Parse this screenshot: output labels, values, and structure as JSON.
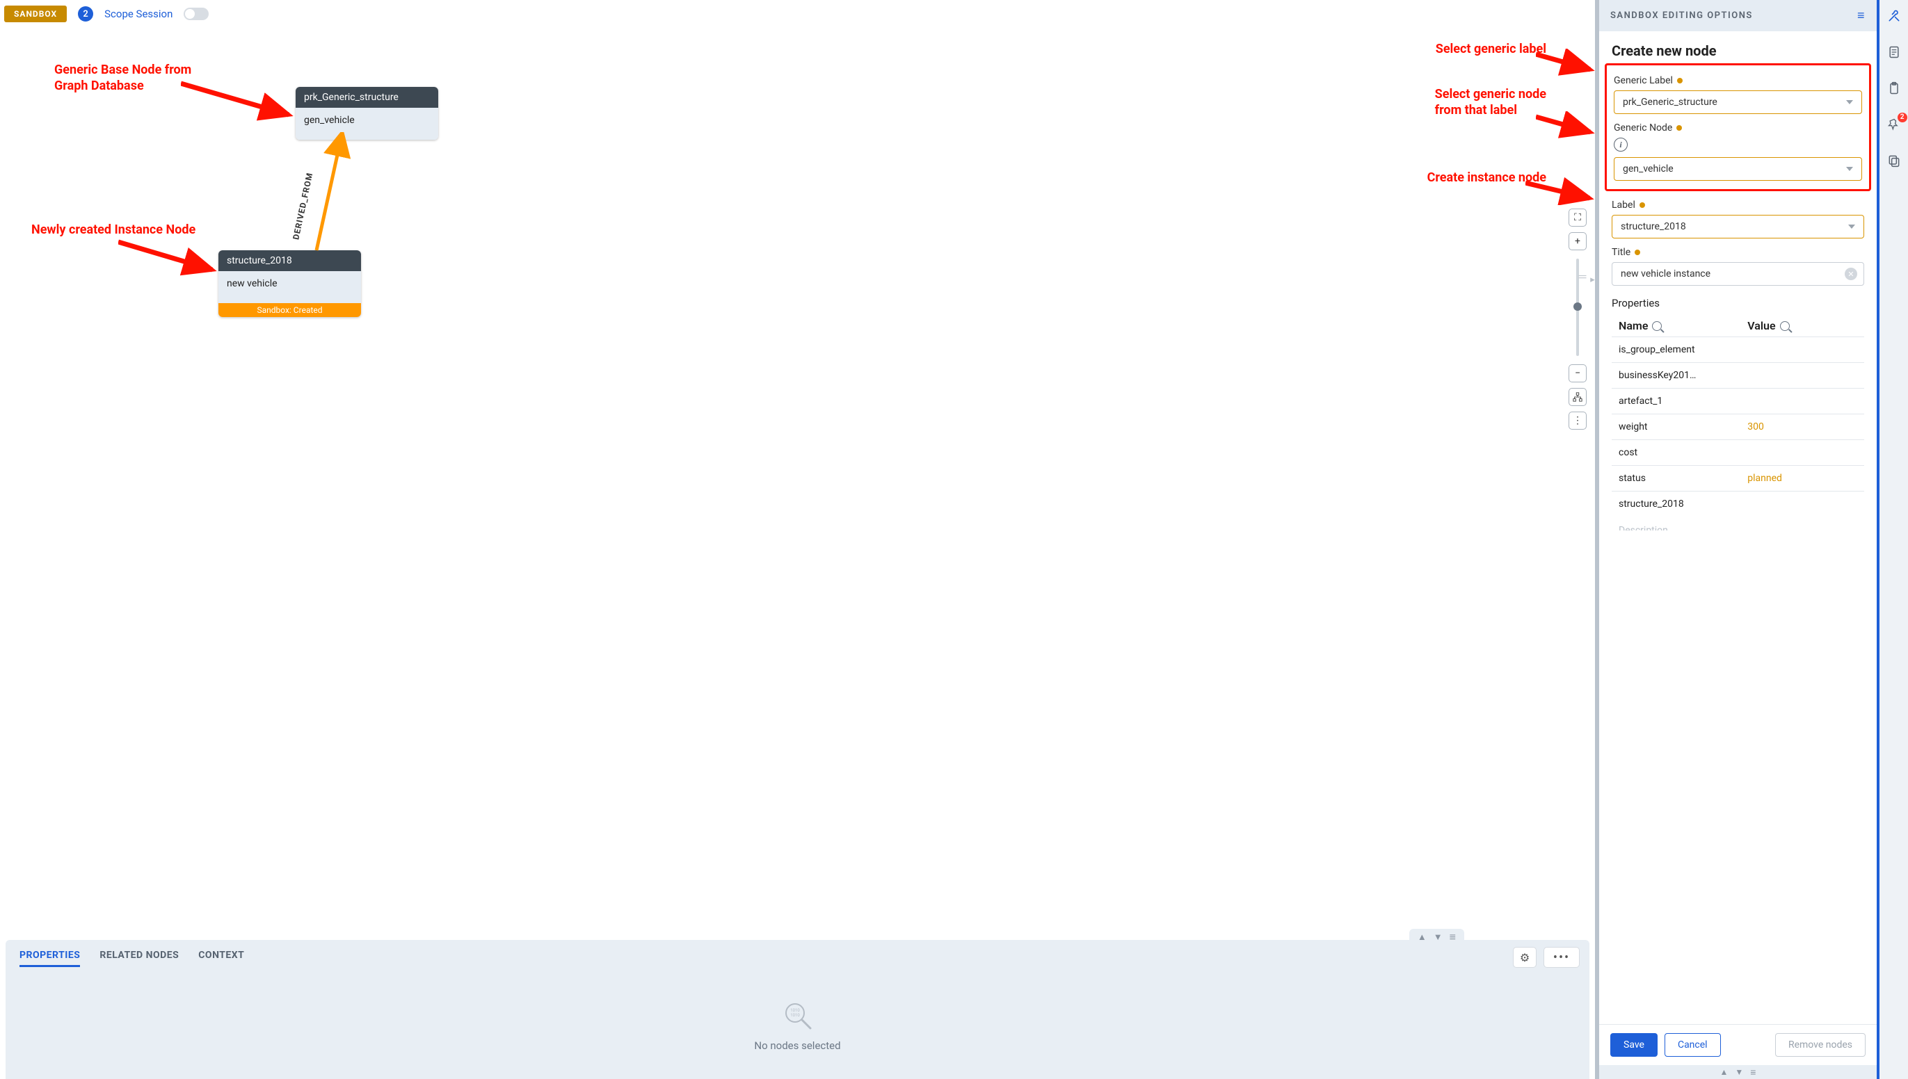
{
  "topbar": {
    "sandbox_badge": "SANDBOX",
    "count": "2",
    "scope_session": "Scope Session"
  },
  "annotations": {
    "generic_base": "Generic Base Node from\nGraph Database",
    "newly_created": "Newly created Instance Node",
    "select_label": "Select generic label",
    "select_node": "Select generic node\nfrom that label",
    "create_instance": "Create instance node"
  },
  "canvas": {
    "node1": {
      "header": "prk_Generic_structure",
      "body": "gen_vehicle"
    },
    "node2": {
      "header": "structure_2018",
      "body": "new vehicle",
      "footer": "Sandbox: Created"
    },
    "edge_label": "DERIVED_FROM"
  },
  "bottom_panel": {
    "tabs": {
      "properties": "PROPERTIES",
      "related": "RELATED NODES",
      "context": "CONTEXT"
    },
    "empty": "No nodes selected"
  },
  "sidebar": {
    "head": "SANDBOX EDITING OPTIONS",
    "title": "Create new node",
    "fields": {
      "generic_label": {
        "label": "Generic Label",
        "value": "prk_Generic_structure"
      },
      "generic_node": {
        "label": "Generic Node",
        "value": "gen_vehicle"
      },
      "label": {
        "label": "Label",
        "value": "structure_2018"
      },
      "title_f": {
        "label": "Title",
        "value": "new vehicle instance"
      }
    },
    "properties_heading": "Properties",
    "prop_cols": {
      "name": "Name",
      "value": "Value"
    },
    "props": [
      {
        "name": "is_group_element",
        "value": ""
      },
      {
        "name": "businessKey201…",
        "value": ""
      },
      {
        "name": "artefact_1",
        "value": ""
      },
      {
        "name": "weight",
        "value": "300"
      },
      {
        "name": "cost",
        "value": ""
      },
      {
        "name": "status",
        "value": "planned"
      },
      {
        "name": "structure_2018",
        "value": ""
      }
    ],
    "description_label": "Description",
    "buttons": {
      "save": "Save",
      "cancel": "Cancel",
      "remove": "Remove nodes"
    }
  },
  "rail": {
    "badge": "2"
  },
  "icons": {
    "expand": "⛶",
    "plus": "+",
    "minus": "−",
    "tree": "⌬",
    "dots": "⋮",
    "menu": "≡",
    "gear": "⚙",
    "more": "•••",
    "up": "▲",
    "down": "▼"
  }
}
